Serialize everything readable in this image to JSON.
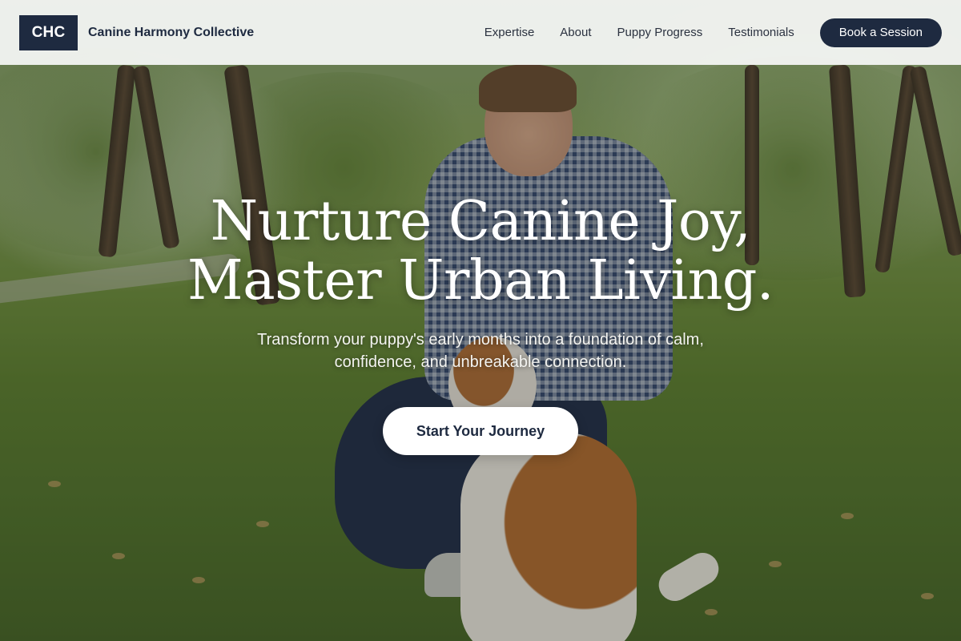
{
  "header": {
    "logo_text": "CHC",
    "brand_name": "Canine Harmony Collective",
    "nav": [
      {
        "label": "Expertise"
      },
      {
        "label": "About"
      },
      {
        "label": "Puppy Progress"
      },
      {
        "label": "Testimonials"
      }
    ],
    "cta_label": "Book a Session"
  },
  "hero": {
    "title_line1": "Nurture Canine Joy,",
    "title_line2": "Master Urban Living.",
    "subtitle": "Transform your puppy's early months into a foundation of calm, confidence, and unbreakable connection.",
    "cta_label": "Start Your Journey"
  },
  "colors": {
    "brand_navy": "#1e2a40",
    "header_bg": "#f6f7f6",
    "cta_bg": "#ffffff"
  }
}
